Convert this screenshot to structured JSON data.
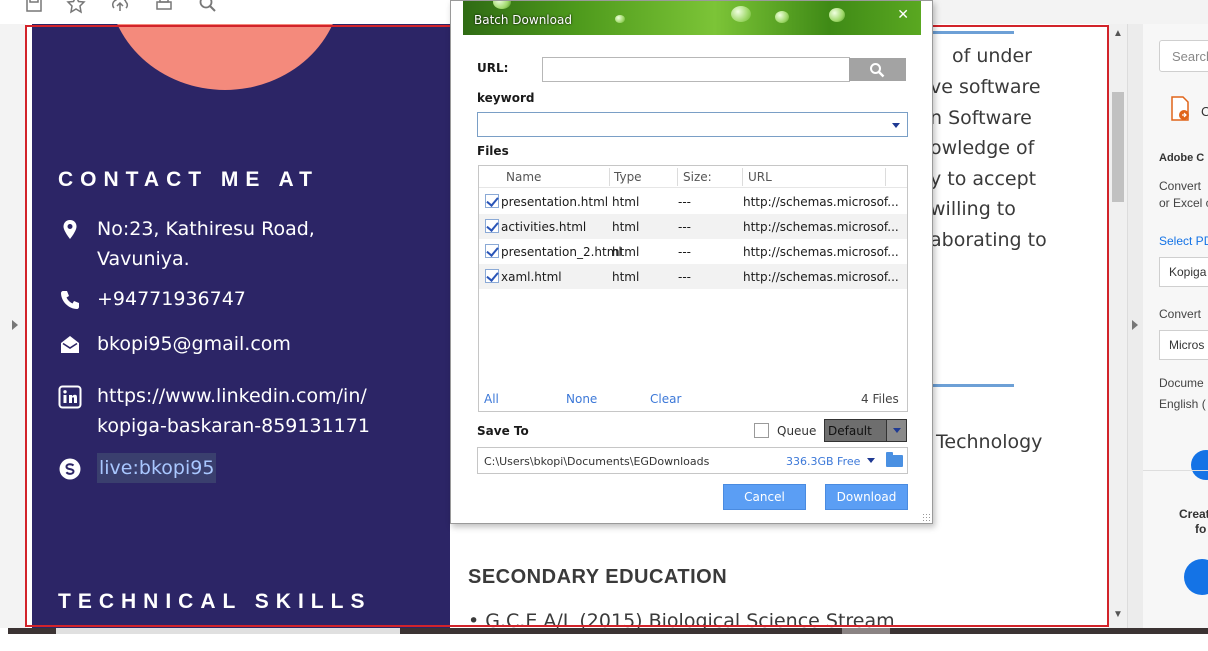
{
  "dialog": {
    "title": "Batch Download",
    "close": "✕",
    "url_label": "URL:",
    "url_value": "",
    "keyword_label": "keyword",
    "files_label": "Files",
    "columns": [
      "Name",
      "Type",
      "Size:",
      "URL"
    ],
    "files": [
      {
        "name": "presentation.html",
        "type": "html",
        "size": "---",
        "url": "http://schemas.microsof..."
      },
      {
        "name": "activities.html",
        "type": "html",
        "size": "---",
        "url": "http://schemas.microsof..."
      },
      {
        "name": "presentation_2.html",
        "type": "html",
        "size": "---",
        "url": "http://schemas.microsof..."
      },
      {
        "name": "xaml.html",
        "type": "html",
        "size": "---",
        "url": "http://schemas.microsof..."
      }
    ],
    "select_all": "All",
    "select_none": "None",
    "clear": "Clear",
    "file_count": "4 Files",
    "save_to_label": "Save To",
    "queue_label": "Queue",
    "default_option": "Default",
    "save_path": "C:\\Users\\bkopi\\Documents\\EGDownloads",
    "free_space": "336.3GB Free",
    "cancel": "Cancel",
    "download": "Download"
  },
  "resume": {
    "contact_heading": "CONTACT ME AT",
    "address_line1": "No:23, Kathiresu Road,",
    "address_line2": "Vavuniya.",
    "phone": "+94771936747",
    "email": "bkopi95@gmail.com",
    "linkedin_line1": "https://www.linkedin.com/in/",
    "linkedin_line2": "kopiga-baskaran-859131171",
    "skype": "live:bkopi95",
    "skills_heading": "TECHNICAL SKILLS",
    "body_lines": [
      "of under",
      "ve software",
      "n Software",
      "owledge of",
      "y to accept",
      "willing to",
      "aborating to"
    ],
    "tech_fragment": "Technology",
    "education_heading": "SECONDARY EDUCATION",
    "education_bullet": "G.C.E A/L (2015) Biological Science Stream"
  },
  "tools_pane": {
    "search_placeholder": "Search",
    "c_label": "C",
    "adobe_label": "Adobe C",
    "convert_line1": "Convert",
    "convert_line2": "or Excel c",
    "select_pdf": "Select PD",
    "kopiga_field": "Kopiga",
    "convert_to": "Convert",
    "microsoft_field": "Micros",
    "document_lang": "Docume",
    "english": "English (",
    "create_label": "Creat",
    "fo_label": "fo"
  },
  "colors": {
    "sidebar": "#2c2566",
    "avatar": "#f48a7c",
    "accent_blue": "#5b9ef4",
    "selection_red": "#d2232a",
    "rule_blue": "#6da0d6"
  }
}
